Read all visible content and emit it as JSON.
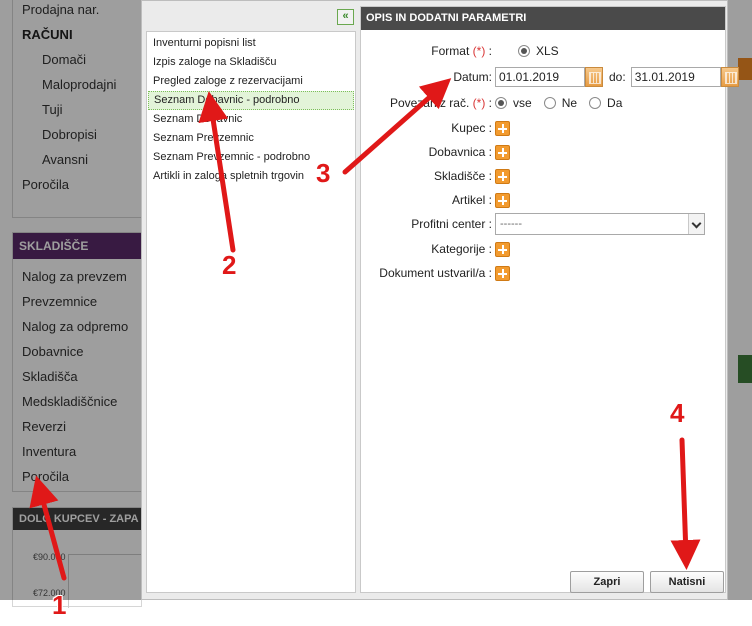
{
  "sidebar": {
    "top_items": [
      {
        "label": "Prodajna nar.",
        "kind": "item"
      },
      {
        "label": "RAČUNI",
        "kind": "section"
      },
      {
        "label": "Domači",
        "kind": "sub"
      },
      {
        "label": "Maloprodajni",
        "kind": "sub"
      },
      {
        "label": "Tuji",
        "kind": "sub"
      },
      {
        "label": "Dobropisi",
        "kind": "sub"
      },
      {
        "label": "Avansni",
        "kind": "sub"
      },
      {
        "label": "Poročila",
        "kind": "item"
      }
    ],
    "skladisce_title": "SKLADIŠČE",
    "skladisce_items": [
      "Nalog za prevzem",
      "Prevzemnice",
      "Nalog za odpremo",
      "Dobavnice",
      "Skladišča",
      "Medskladiščnice",
      "Reverzi",
      "Inventura",
      "Poročila"
    ],
    "chart_title": "DOLG KUPCEV - ZAPA",
    "chart_labels": [
      "€90.000",
      "€72.000"
    ]
  },
  "dialog": {
    "reports": [
      "Inventurni popisni list",
      "Izpis zaloge na Skladišču",
      "Pregled zaloge z rezervacijami",
      "Seznam Dobavnic - podrobno",
      "Seznam Dobavnic",
      "Seznam Prevzemnic",
      "Seznam Prevzemnic - podrobno",
      "Artikli in zaloga spletnih trgovin"
    ],
    "selected_index": 3,
    "collapse_glyph": "«",
    "params_title": "OPIS IN DODATNI PARAMETRI",
    "format_label": "Format",
    "format_value": "XLS",
    "required_mark": "(*)",
    "datum_label": "Datum:",
    "date_from": "01.01.2019",
    "do_label": "do:",
    "date_to": "31.01.2019",
    "povezan_label": "Povezan z rač.",
    "povezan_options": [
      "vse",
      "Ne",
      "Da"
    ],
    "kupec_label": "Kupec :",
    "dobavnica_label": "Dobavnica :",
    "skladisce_label": "Skladišče :",
    "artikel_label": "Artikel :",
    "profitni_label": "Profitni center :",
    "profitni_value": "------",
    "kategorije_label": "Kategorije :",
    "dokument_label": "Dokument ustvaril/a :",
    "close_button": "Zapri",
    "print_button": "Natisni"
  },
  "annotations": [
    "1",
    "2",
    "3",
    "4"
  ],
  "colors": {
    "accent": "#e01818",
    "header": "#4a4a4a",
    "skladisce": "#5b2a6b",
    "plus": "#f29b2f"
  }
}
